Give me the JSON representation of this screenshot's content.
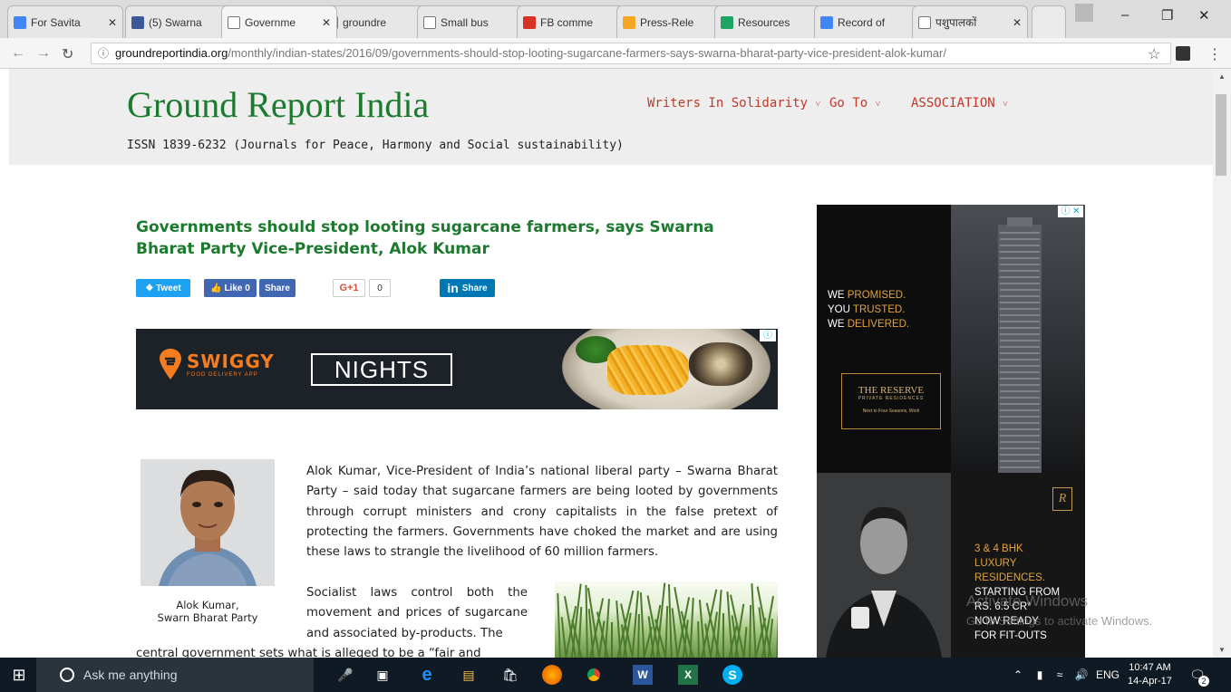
{
  "browser": {
    "tabs": [
      {
        "label": "For Savita",
        "icon": "docs-icon",
        "color": "#4285f4"
      },
      {
        "label": "(5) Swarna",
        "icon": "facebook-icon",
        "color": "#3b5998"
      },
      {
        "label": "Governme",
        "icon": "page-icon",
        "color": "#ffffff",
        "active": true
      },
      {
        "label": "groundre",
        "icon": "page-icon",
        "color": "#ffffff"
      },
      {
        "label": "Small bus",
        "icon": "page-icon",
        "color": "#ffffff"
      },
      {
        "label": "FB comme",
        "icon": "gmail-icon",
        "color": "#d93025"
      },
      {
        "label": "Press-Rele",
        "icon": "sbp-icon",
        "color": "#f5a623"
      },
      {
        "label": "Resources",
        "icon": "drive-icon",
        "color": "#1fa463"
      },
      {
        "label": "Record of",
        "icon": "docs-icon",
        "color": "#4285f4"
      },
      {
        "label": "पशुपालकों",
        "icon": "page-icon",
        "color": "#ffffff"
      }
    ],
    "url_host": "groundreportindia.org",
    "url_path": "/monthly/indian-states/2016/09/governments-should-stop-looting-sugarcane-farmers-says-swarna-bharat-party-vice-president-alok-kumar/"
  },
  "site": {
    "title": "Ground Report India",
    "issn": "ISSN 1839-6232 (Journals for Peace, Harmony and Social sustainability)",
    "nav": [
      "Writers In Solidarity",
      "Go To",
      "ASSOCIATION"
    ],
    "brand_color": "#1c7a2e",
    "nav_color": "#c0392b"
  },
  "article": {
    "title": "Governments should stop looting sugarcane farmers, says Swarna Bharat Party Vice-President, Alok Kumar",
    "share": {
      "tweet": "Tweet",
      "like": "Like 0",
      "fb_share": "Share",
      "gplus": "G+1",
      "gplus_count": "0",
      "linkedin": "Share"
    },
    "photo_caption_1": "Alok Kumar,",
    "photo_caption_2": "Swarn Bharat Party",
    "para1": "Alok Kumar, Vice-President of India’s national liberal party – Swarna Bharat Party – said today that sugarcane farmers are being looted by governments through corrupt ministers and crony capitalists in the false pretext of protecting the farmers. Governments have choked the market and are using these laws to strangle the livelihood of 60 million farmers.",
    "para2": "Socialist laws control both the movement and prices of sugarcane and associated by-products. The",
    "para2_cont": "central government sets what is alleged to be a “fair and"
  },
  "ads": {
    "swiggy_name": "SWIGGY",
    "swiggy_sub": "FOOD DELIVERY APP",
    "swiggy_tag": "NIGHTS",
    "promise_1a": "WE ",
    "promise_1b": "PROMISED.",
    "promise_2a": "YOU ",
    "promise_2b": "TRUSTED.",
    "promise_3a": "WE ",
    "promise_3b": "DELIVERED.",
    "reserve_title": "THE RESERVE",
    "reserve_sub": "PRIVATE RESIDENCES",
    "reserve_loc": "Next to Four Seasons, Worli",
    "lux_1": "3 & 4 BHK",
    "lux_2": "LUXURY",
    "lux_3": "RESIDENCES.",
    "lux_4": "STARTING FROM",
    "lux_5": "RS. 6.5 CR*",
    "lux_6": "NOW READY",
    "lux_7": "FOR FIT-OUTS"
  },
  "windows": {
    "search_placeholder": "Ask me anything",
    "lang": "ENG",
    "time": "10:47 AM",
    "date": "14-Apr-17",
    "notif_count": "2",
    "activate_1": "Activate Windows",
    "activate_2": "Go to Settings to activate Windows."
  }
}
